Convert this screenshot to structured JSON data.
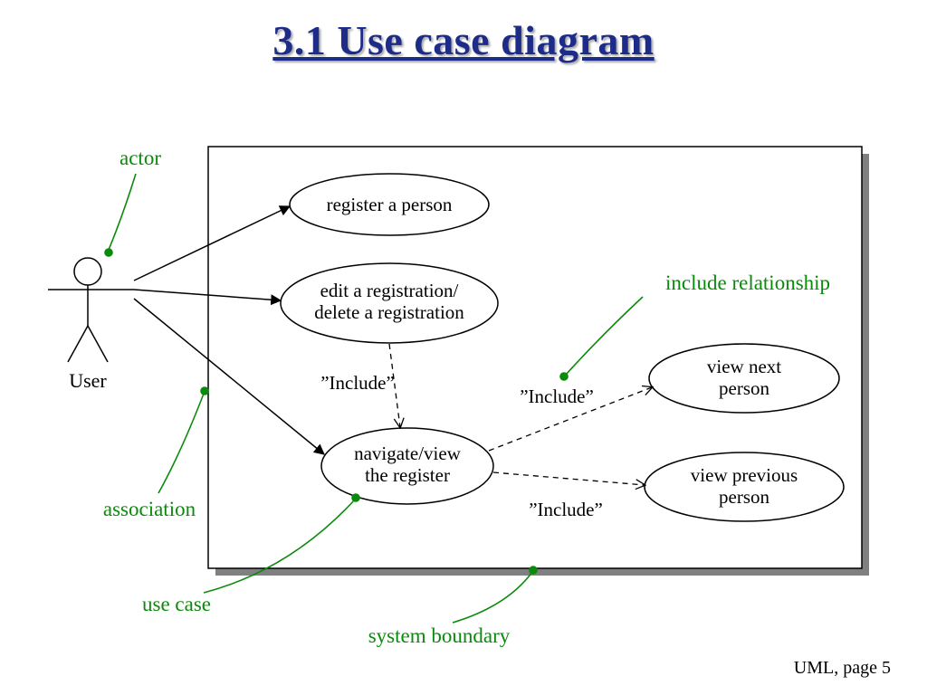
{
  "title": "3.1 Use case diagram",
  "footer": "UML, page  5",
  "actor_name": "User",
  "usecases": {
    "uc1": "register a person",
    "uc2a": "edit a registration/",
    "uc2b": "delete a registration",
    "uc3a": "navigate/view",
    "uc3b": "the register",
    "uc4a": "view next",
    "uc4b": "person",
    "uc5a": "view previous",
    "uc5b": "person"
  },
  "include_labels": {
    "i1": "”Include”",
    "i2": "”Include”",
    "i3": "”Include”"
  },
  "annotations": {
    "actor": "actor",
    "association": "association",
    "usecase": "use case",
    "boundary": "system boundary",
    "include": "include relationship"
  }
}
